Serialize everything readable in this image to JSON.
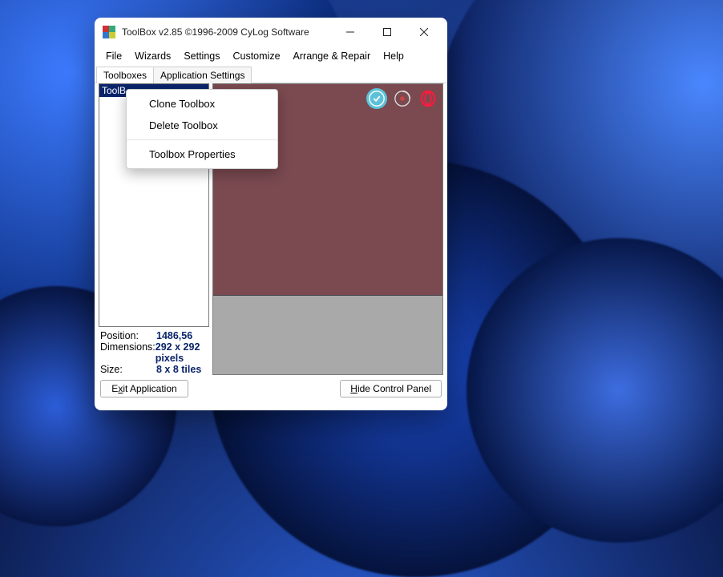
{
  "window": {
    "title": "ToolBox v2.85 ©1996-2009 CyLog Software"
  },
  "menu": {
    "file": "File",
    "wizards": "Wizards",
    "settings": "Settings",
    "customize": "Customize",
    "arrange": "Arrange & Repair",
    "help": "Help"
  },
  "tabs": {
    "toolboxes": "Toolboxes",
    "app_settings": "Application Settings"
  },
  "list": {
    "selected_item": "ToolB"
  },
  "info": {
    "position_label": "Position:",
    "position_value": "1486,56",
    "dimensions_label": "Dimensions:",
    "dimensions_value": "292 x 292 pixels",
    "size_label": "Size:",
    "size_value": "8 x 8 tiles"
  },
  "buttons": {
    "exit_prefix": "E",
    "exit_underline": "x",
    "exit_suffix": "it Application",
    "hide_underline": "H",
    "hide_suffix": "ide Control Panel"
  },
  "context_menu": {
    "clone": "Clone Toolbox",
    "delete": "Delete Toolbox",
    "properties": "Toolbox Properties"
  },
  "icons": {
    "tile1": "app1-icon",
    "tile2": "disc-icon",
    "tile3": "opera-icon"
  }
}
